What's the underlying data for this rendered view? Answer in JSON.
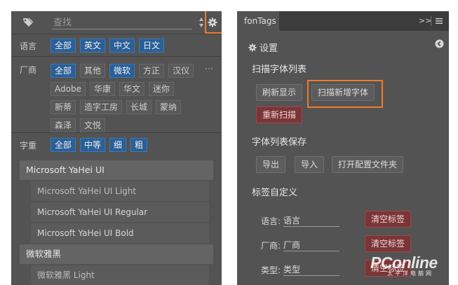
{
  "left": {
    "search": {
      "placeholder": "查找"
    },
    "language": {
      "label": "语言",
      "chips": [
        "全部",
        "英文",
        "中文",
        "日文"
      ]
    },
    "vendor": {
      "label": "厂商",
      "chips": [
        "全部",
        "其他",
        "微软",
        "方正",
        "汉仪",
        "Adobe",
        "华康",
        "华文",
        "迷你",
        "新蒂",
        "造字工房",
        "长城",
        "蒙纳",
        "森泽",
        "文悦"
      ]
    },
    "weight": {
      "label": "字重",
      "chips": [
        "全部",
        "中等",
        "细",
        "粗"
      ]
    },
    "fonts": [
      {
        "family": "Microsoft YaHei UI",
        "faces": [
          "Microsoft YaHei UI Light",
          "Microsoft YaHei UI Regular",
          "Microsoft YaHei UI Bold"
        ]
      },
      {
        "family": "微软雅黑",
        "faces": [
          "微软雅黑 Light"
        ]
      }
    ]
  },
  "right": {
    "tab": "fonTags",
    "expand": ">>",
    "settings_title": "设置",
    "scan_section": {
      "title": "扫描字体列表",
      "refresh": "刷新显示",
      "scan_new": "扫描新增字体",
      "rescan": "重新扫描"
    },
    "save_section": {
      "title": "字体列表保存",
      "export": "导出",
      "import": "导入",
      "open_config": "打开配置文件夹"
    },
    "tags_section": {
      "title": "标签自定义",
      "rows": [
        {
          "label": "语言:",
          "value": "语言",
          "clear": "清空标签"
        },
        {
          "label": "厂商:",
          "value": "厂商",
          "clear": "清空标签"
        },
        {
          "label": "类型:",
          "value": "类型",
          "clear": "清空标签"
        }
      ]
    }
  },
  "watermark": {
    "brand": "PConline",
    "sub": "太平洋电脑网"
  },
  "colors": {
    "panel": "#535353",
    "accent_blue": "#2a5f97",
    "danger": "#7a3537",
    "highlight": "#f07a2a"
  }
}
